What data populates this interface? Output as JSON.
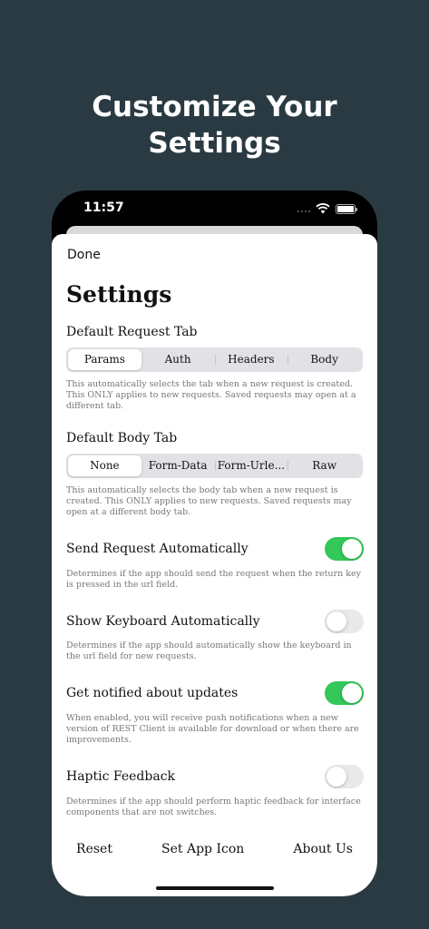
{
  "headline": {
    "line1": "Customize Your",
    "line2": "Settings"
  },
  "status": {
    "time": "11:57"
  },
  "nav": {
    "done_label": "Done"
  },
  "title": "Settings",
  "default_request_tab": {
    "label": "Default Request Tab",
    "segments": [
      "Params",
      "Auth",
      "Headers",
      "Body"
    ],
    "selected": "Params",
    "hint": "This automatically selects the tab when a new request is created. This ONLY applies to new requests. Saved requests may open at a different tab."
  },
  "default_body_tab": {
    "label": "Default Body Tab",
    "segments": [
      "None",
      "Form-Data",
      "Form-Urle...",
      "Raw"
    ],
    "selected": "None",
    "hint": "This automatically selects the body tab when a new request is created. This ONLY applies to new requests. Saved requests may open at a different body tab."
  },
  "toggles": [
    {
      "label": "Send Request Automatically",
      "on": true,
      "hint": "Determines if the app should send the request when the return key is pressed in the url field."
    },
    {
      "label": "Show Keyboard Automatically",
      "on": false,
      "hint": "Determines if the app should automatically show the keyboard in the url field for new requests."
    },
    {
      "label": "Get notified about updates",
      "on": true,
      "hint": "When enabled, you will receive push notifications when a new version of REST Client is available for download or when there are improvements."
    },
    {
      "label": "Haptic Feedback",
      "on": false,
      "hint": "Determines if the app should perform haptic feedback for interface components that are not switches."
    }
  ],
  "bottom_actions": {
    "reset": "Reset",
    "set_app_icon": "Set App Icon",
    "about_us": "About Us"
  },
  "colors": {
    "background": "#2a3a42",
    "toggle_on": "#34c759",
    "toggle_off": "#e9e9eb"
  }
}
